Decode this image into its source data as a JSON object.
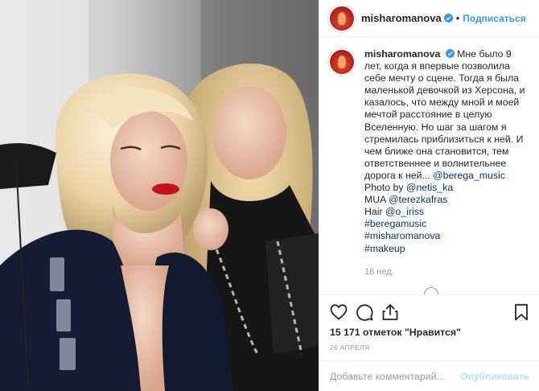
{
  "post": {
    "username": "misharomanova",
    "follow_label": "Подписаться",
    "dot": "•",
    "caption": {
      "username": "misharomanova",
      "text": "Мне было 9 лет, когда я впервые позволила себе мечту о сцене. Тогда я была маленькой девочкой из Херсона, и казалось, что между мной и моей мечтой расстояние в целую Вселенную. Но шаг за шагом я стремилась приблизиться к ней. И чем ближе она становится, тем ответственнее и волнительнее дорога к ней... ",
      "mention1": "@berega_music",
      "photo_by_label": "Photo by ",
      "photo_by": "@netis_ka",
      "mua_label": "MUA ",
      "mua": "@terezkafras",
      "hair_label": "Hair ",
      "hair": "@o_iriss",
      "hashtags": [
        "#beregamusic",
        "#misharomanova",
        "#makeup"
      ],
      "age": "16 нед."
    },
    "likes": "15 171 отметок \"Нравится\"",
    "date": "26 АПРЕЛЯ",
    "comment_placeholder": "Добавьте комментарий...",
    "publish_label": "Опубликовать"
  },
  "icons": {
    "like": "heart-icon",
    "comment": "comment-icon",
    "share": "share-icon",
    "save": "bookmark-icon",
    "verified": "verified-badge-icon"
  },
  "colors": {
    "accent": "#3897f0",
    "link": "#003569",
    "muted": "#999999",
    "publish_disabled": "#b2dffc"
  }
}
